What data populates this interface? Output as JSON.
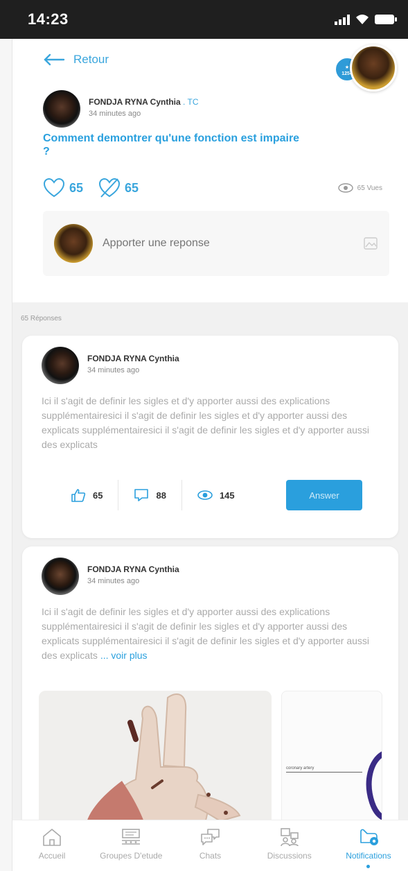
{
  "status_bar": {
    "time": "14:23"
  },
  "nav": {
    "back_label": "Retour",
    "badge": "1254"
  },
  "post": {
    "author": "FONDJA RYNA Cynthia",
    "tag": ". TC",
    "time_ago": "34 minutes ago",
    "question": "Comment demontrer qu'une fonction est impaire ?",
    "likes": "65",
    "dislikes": "65",
    "views": "65 Vues",
    "reply_placeholder": "Apporter une reponse"
  },
  "responses_count": "65 Réponses",
  "responses": [
    {
      "author": "FONDJA RYNA Cynthia",
      "time_ago": "34 minutes ago",
      "body": "Ici il s'agit de definir les sigles et d'y apporter aussi des explications supplémentairesici il s'agit de definir les sigles et d'y apporter aussi des explicats supplémentairesici il s'agit de definir les sigles et d'y apporter aussi des explicats",
      "likes": "65",
      "comments": "88",
      "views": "145",
      "answer_label": "Answer"
    },
    {
      "author": "FONDJA RYNA Cynthia",
      "time_ago": "34 minutes ago",
      "body": "Ici il s'agit de definir les sigles et d'y apporter aussi des explications supplémentairesici il s'agit de definir les sigles et d'y apporter aussi des explicats supplémentairesici il s'agit de definir les sigles et d'y apporter aussi des explicats",
      "more": "... voir plus",
      "image_label": "coronary artery"
    }
  ],
  "bottom_nav": [
    {
      "label": "Accueil"
    },
    {
      "label": "Groupes D'etude"
    },
    {
      "label": "Chats"
    },
    {
      "label": "Discussions"
    },
    {
      "label": "Notifications"
    }
  ],
  "colors": {
    "accent": "#2a9fdd",
    "status_bar": "#1f1f1f",
    "section_bg": "#f1f1f1"
  }
}
